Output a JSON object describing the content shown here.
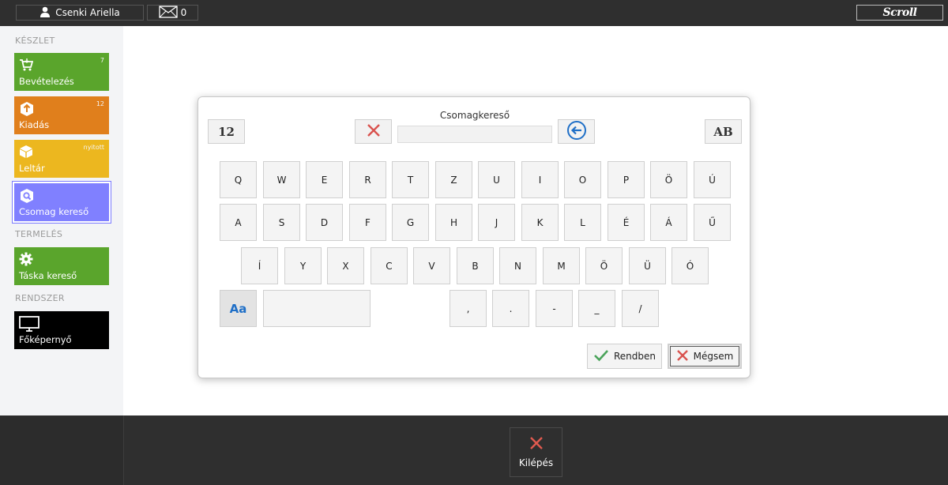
{
  "topbar": {
    "user_name": "Csenki Ariella",
    "message_count": "0",
    "logo_text": "Scroll"
  },
  "sidebar": {
    "sections": {
      "keszlet": "KÉSZLET",
      "termeles": "TERMELÉS",
      "rendszer": "RENDSZER"
    },
    "tiles": [
      {
        "label": "Bevételezés",
        "badge": "7",
        "color": "#5aa52c",
        "icon": "cart-icon"
      },
      {
        "label": "Kiadás",
        "badge": "12",
        "color": "#e07f1c",
        "icon": "box-up-icon"
      },
      {
        "label": "Leltár",
        "badge": "nyitott",
        "color": "#ecb71f",
        "icon": "box-icon"
      },
      {
        "label": "Csomag kereső",
        "badge": "",
        "color": "#8080ff",
        "icon": "box-search-icon"
      },
      {
        "label": "Táska kereső",
        "badge": "",
        "color": "#5aa52c",
        "icon": "gear-icon"
      },
      {
        "label": "Főképernyő",
        "badge": "",
        "color": "#000000",
        "icon": "monitor-icon"
      }
    ]
  },
  "dialog": {
    "title": "Csomagkereső",
    "numeric_mode_label": "12",
    "alpha_mode_label": "AB",
    "search_value": "",
    "keyboard": {
      "row1": [
        "Q",
        "W",
        "E",
        "R",
        "T",
        "Z",
        "U",
        "I",
        "O",
        "P",
        "Ö",
        "Ú"
      ],
      "row2": [
        "A",
        "S",
        "D",
        "F",
        "G",
        "H",
        "J",
        "K",
        "L",
        "É",
        "Á",
        "Ű"
      ],
      "row3": [
        "Í",
        "Y",
        "X",
        "C",
        "V",
        "B",
        "N",
        "M",
        "Ö",
        "Ü",
        "Ó"
      ],
      "case_label": "Aa",
      "row4": [
        ",",
        ".",
        "-",
        "_",
        "/"
      ]
    },
    "ok_label": "Rendben",
    "cancel_label": "Mégsem"
  },
  "footer": {
    "exit_label": "Kilépés"
  },
  "colors": {
    "topbar": "#2f2f2f",
    "accent_blue": "#1f6fc7",
    "cancel_red": "#d9534f",
    "ok_green": "#4aa35a"
  }
}
